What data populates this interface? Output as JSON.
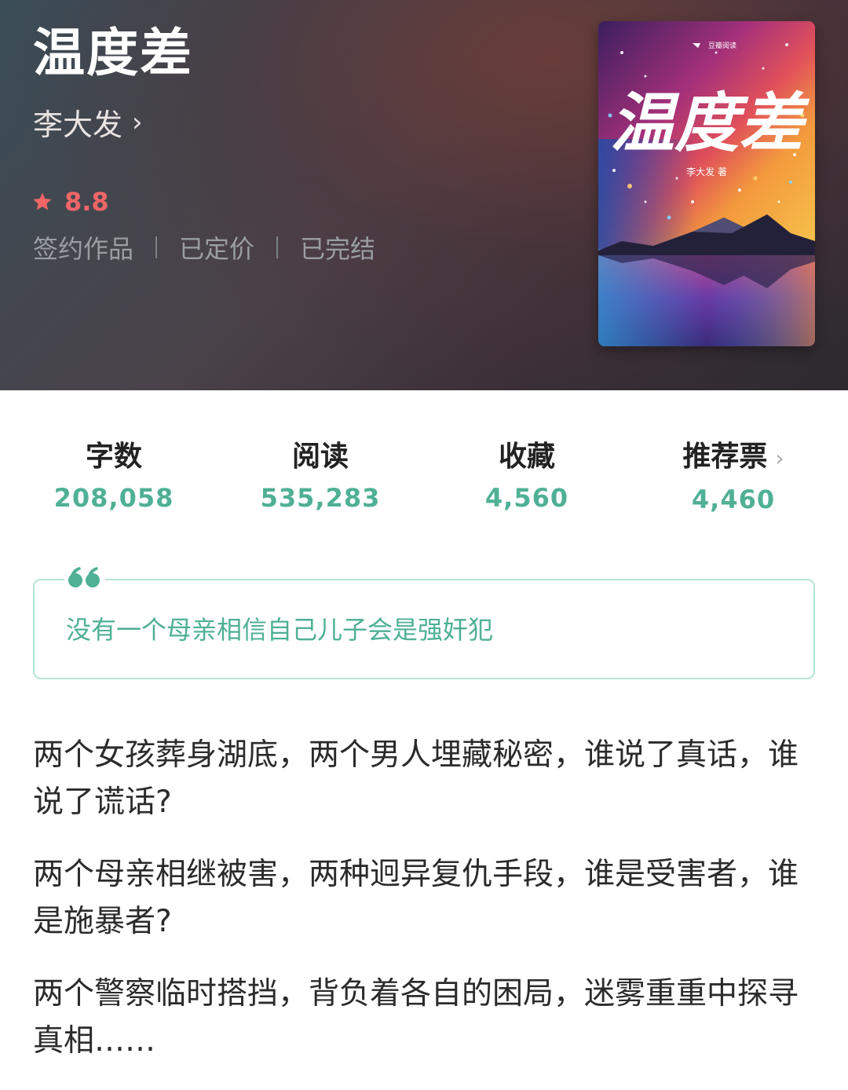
{
  "book": {
    "title": "温度差",
    "author": "李大发",
    "author_chevron": "›",
    "rating": "8.8",
    "tags": [
      "签约作品",
      "已定价",
      "已完结"
    ]
  },
  "cover": {
    "publisher": "豆瓣阅读",
    "title": "温度差",
    "byline": "李大发 著"
  },
  "stats": [
    {
      "label": "字数",
      "value": "208,058"
    },
    {
      "label": "阅读",
      "value": "535,283"
    },
    {
      "label": "收藏",
      "value": "4,560"
    },
    {
      "label": "推荐票",
      "value": "4,460",
      "chevron": "›"
    }
  ],
  "quote": {
    "text": "没有一个母亲相信自己儿子会是强奸犯"
  },
  "description": [
    "两个女孩葬身湖底，两个男人埋藏秘密，谁说了真话，谁说了谎话?",
    "两个母亲相继被害，两种迥异复仇手段，谁是受害者，谁是施暴者?",
    "两个警察临时搭挡，背负着各自的困局，迷雾重重中探寻真相……"
  ],
  "colors": {
    "accent": "#4fb095",
    "rating": "#f06666",
    "quote_border": "#b8e3d6"
  },
  "icons": {
    "rating": "star-icon",
    "quote": "quote-open-icon",
    "author": "chevron-right-icon"
  }
}
